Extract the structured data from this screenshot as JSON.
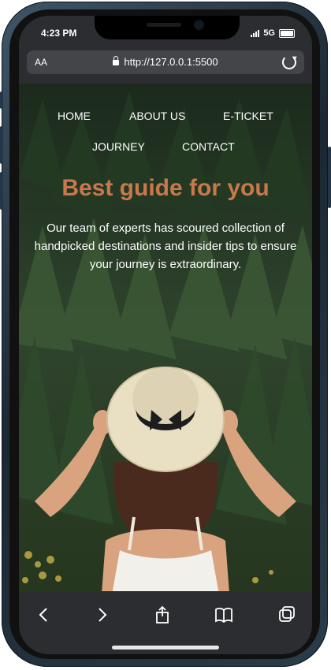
{
  "status_bar": {
    "time": "4:23 PM",
    "network": "5G"
  },
  "browser": {
    "reader_label": "AA",
    "url": "http://127.0.0.1:5500"
  },
  "nav": {
    "items": [
      "HOME",
      "ABOUT US",
      "E-TICKET",
      "JOURNEY",
      "CONTACT"
    ]
  },
  "hero": {
    "title": "Best guide for you",
    "description": "Our team of experts has scoured collection of handpicked destinations and insider tips to ensure your journey is extraordinary."
  },
  "colors": {
    "accent": "#c9784c",
    "chrome": "#2b2d31",
    "urlbar": "#43454a"
  },
  "icons": [
    "back-icon",
    "forward-icon",
    "share-icon",
    "bookmarks-icon",
    "tabs-icon",
    "reload-icon",
    "lock-icon",
    "signal-icon",
    "battery-icon"
  ]
}
